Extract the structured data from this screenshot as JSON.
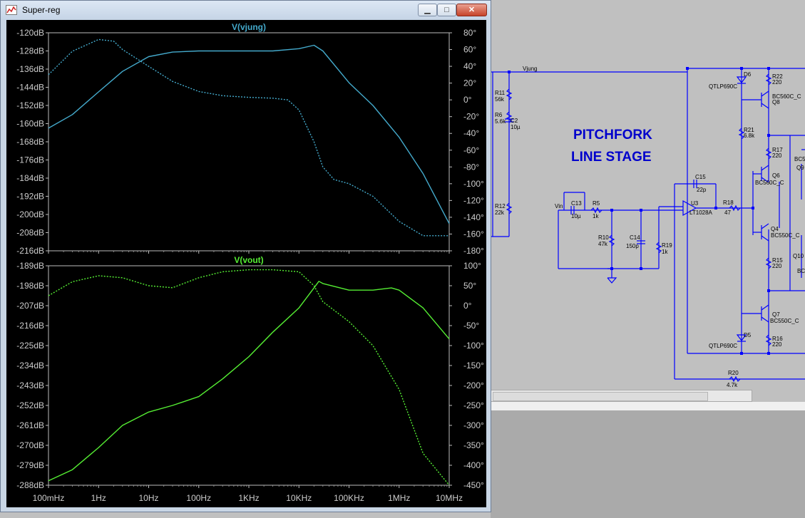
{
  "window": {
    "title": "Super-reg",
    "minimize_icon": "minimize-icon",
    "maximize_icon": "maximize-icon",
    "close_icon": "close-icon",
    "min_glyph": "▁",
    "max_glyph": "□",
    "close_glyph": "✕"
  },
  "plots": [
    {
      "title": "V(vjung)",
      "color": "#44aacc",
      "y_left": [
        "-120dB",
        "-128dB",
        "-136dB",
        "-144dB",
        "-152dB",
        "-160dB",
        "-168dB",
        "-176dB",
        "-184dB",
        "-192dB",
        "-200dB",
        "-208dB",
        "-216dB"
      ],
      "y_right": [
        "80°",
        "60°",
        "40°",
        "20°",
        "0°",
        "-20°",
        "-40°",
        "-60°",
        "-80°",
        "-100°",
        "-120°",
        "-140°",
        "-160°",
        "-180°"
      ]
    },
    {
      "title": "V(vout)",
      "color": "#55ee33",
      "y_left": [
        "-189dB",
        "-198dB",
        "-207dB",
        "-216dB",
        "-225dB",
        "-234dB",
        "-243dB",
        "-252dB",
        "-261dB",
        "-270dB",
        "-279dB",
        "-288dB"
      ],
      "y_right": [
        "100°",
        "50°",
        "0°",
        "-50°",
        "-100°",
        "-150°",
        "-200°",
        "-250°",
        "-300°",
        "-350°",
        "-400°",
        "-450°"
      ]
    }
  ],
  "x_axis": [
    "100mHz",
    "1Hz",
    "10Hz",
    "100Hz",
    "1KHz",
    "10KHz",
    "100KHz",
    "1MHz",
    "10MHz"
  ],
  "chart_data": [
    {
      "type": "line",
      "title": "V(vjung)",
      "x_scale": "log",
      "x_unit": "Hz",
      "xlim": [
        0.1,
        10000000
      ],
      "ylim_left": [
        -216,
        -120
      ],
      "ylim_right": [
        -180,
        80
      ],
      "grid": false,
      "series": [
        {
          "axis": "left",
          "style": "solid",
          "x": [
            0.1,
            0.3,
            1,
            3,
            10,
            30,
            100,
            300,
            1000,
            3000,
            10000,
            20000,
            30000,
            100000,
            300000,
            1000000,
            3000000,
            10000000
          ],
          "y": [
            -162,
            -156,
            -146,
            -137,
            -130.5,
            -128.5,
            -128,
            -128,
            -128,
            -128,
            -127,
            -125.5,
            -128,
            -142,
            -152,
            -166,
            -182,
            -204
          ]
        },
        {
          "axis": "right",
          "style": "dotted",
          "x": [
            0.1,
            0.3,
            1,
            2,
            3,
            10,
            30,
            100,
            300,
            1000,
            3000,
            6000,
            10000,
            20000,
            30000,
            50000,
            100000,
            300000,
            1000000,
            3000000,
            10000000
          ],
          "y": [
            30,
            58,
            72,
            70,
            60,
            40,
            22,
            10,
            5,
            3,
            2,
            0,
            -12,
            -50,
            -80,
            -95,
            -100,
            -115,
            -145,
            -162,
            -162
          ]
        }
      ]
    },
    {
      "type": "line",
      "title": "V(vout)",
      "x_scale": "log",
      "x_unit": "Hz",
      "xlim": [
        0.1,
        10000000
      ],
      "ylim_left": [
        -288,
        -189
      ],
      "ylim_right": [
        -450,
        100
      ],
      "grid": false,
      "series": [
        {
          "axis": "left",
          "style": "solid",
          "x": [
            0.1,
            0.3,
            1,
            3,
            10,
            30,
            100,
            300,
            1000,
            3000,
            10000,
            20000,
            25000,
            30000,
            100000,
            300000,
            700000,
            1000000,
            3000000,
            10000000
          ],
          "y": [
            -286,
            -281,
            -271,
            -261,
            -255,
            -252,
            -248,
            -240,
            -230,
            -219,
            -208,
            -199,
            -196,
            -197,
            -200,
            -200,
            -199,
            -200,
            -208,
            -222
          ]
        },
        {
          "axis": "right",
          "style": "dotted",
          "x": [
            0.1,
            0.3,
            1,
            3,
            10,
            30,
            100,
            300,
            1000,
            3000,
            10000,
            20000,
            30000,
            100000,
            300000,
            1000000,
            3000000,
            10000000
          ],
          "y": [
            25,
            60,
            75,
            70,
            50,
            45,
            70,
            85,
            90,
            90,
            85,
            50,
            10,
            -40,
            -100,
            -210,
            -370,
            -450
          ]
        }
      ]
    }
  ],
  "schematic": {
    "title_line1": "PITCHFORK",
    "title_line2": "LINE STAGE",
    "net_vjung": "Vjung",
    "net_vin": "Vin",
    "labels": {
      "r11": "R11",
      "r11v": "56k",
      "r6": "R6",
      "r6v": "5.6k",
      "c2": "C2",
      "c2v": "10µ",
      "r12": "R12",
      "r12v": "22k",
      "c13": "C13",
      "c13v": "10µ",
      "r5": "R5",
      "r5v": "1k",
      "r10": "R10",
      "r10v": "47k",
      "c14": "C14",
      "c14v": "150p",
      "r19": "R19",
      "r19v": "1k",
      "c15": "C15",
      "c15v": "22p",
      "u3": "U3",
      "u3v": "LT1028A",
      "r18": "R18",
      "r18v": "47",
      "d6": "D6",
      "d6v": "QTLP690C",
      "d5": "D5",
      "d5v": "QTLP690C",
      "r22": "R22",
      "r22v": "220",
      "q8": "Q8",
      "q8v": "BC560C_C",
      "r21": "R21",
      "r21v": "6.8k",
      "r17": "R17",
      "r17v": "220",
      "q6": "Q6",
      "q6v": "BC560C_C",
      "q4": "Q4",
      "q4v": "BC550C_C",
      "r15": "R15",
      "r15v": "220",
      "q7": "Q7",
      "q7v": "BC550C_C",
      "r16": "R16",
      "r16v": "220",
      "r20": "R20",
      "r20v": "4.7k",
      "q9": "Q9",
      "bc5": "BC5",
      "q10": "Q10",
      "bc": "BC"
    }
  }
}
